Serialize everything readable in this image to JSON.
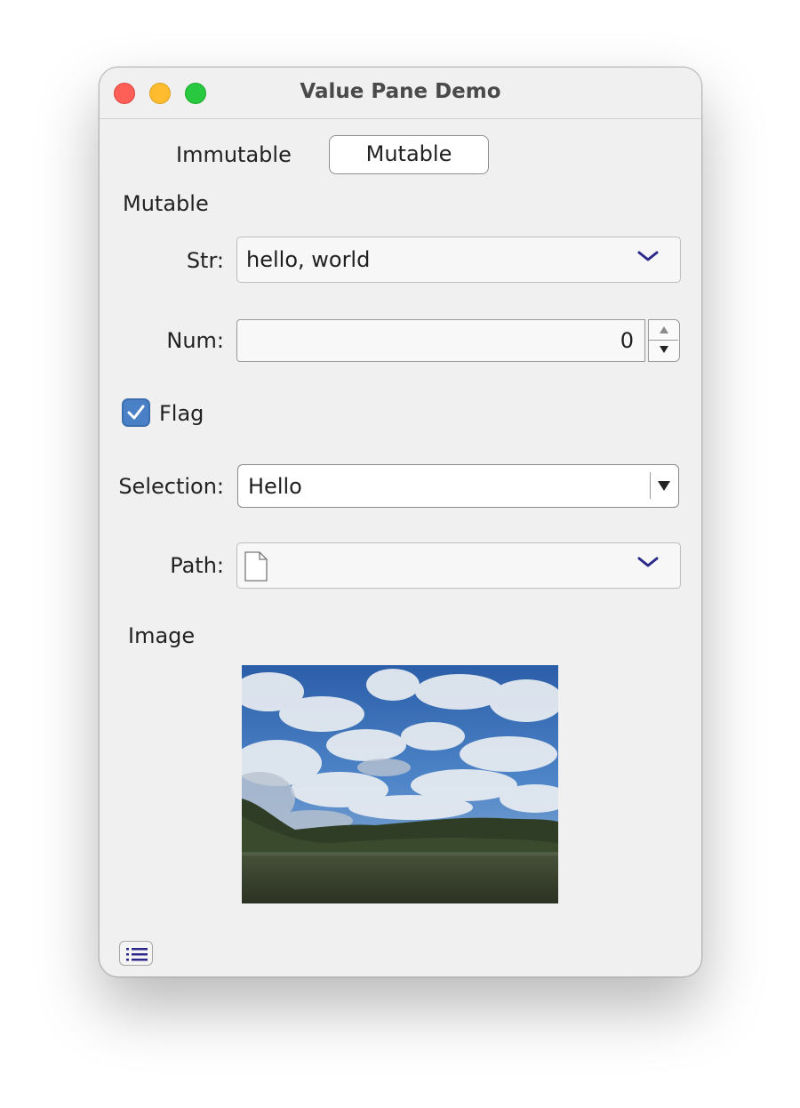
{
  "window": {
    "title": "Value Pane Demo"
  },
  "tabs": [
    {
      "label": "Immutable",
      "selected": false
    },
    {
      "label": "Mutable",
      "selected": true
    }
  ],
  "section_title": "Mutable",
  "fields": {
    "str": {
      "label": "Str:",
      "value": "hello, world"
    },
    "num": {
      "label": "Num:",
      "value": "0"
    },
    "flag": {
      "label": "Flag",
      "checked": true
    },
    "selection": {
      "label": "Selection:",
      "value": "Hello"
    },
    "path": {
      "label": "Path:",
      "value": ""
    }
  },
  "image_section": {
    "label": "Image"
  },
  "colors": {
    "accent": "#4a80c6",
    "chevron": "#2b2a8c",
    "traffic_red": "#fe5f57",
    "traffic_yellow": "#febc2e",
    "traffic_green": "#28c840"
  }
}
